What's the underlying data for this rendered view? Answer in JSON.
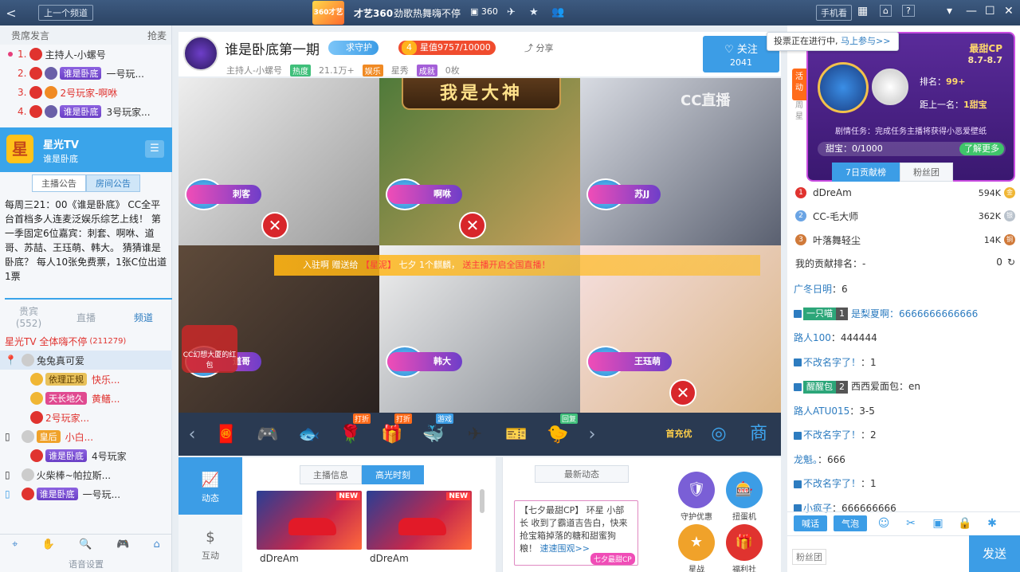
{
  "titlebar": {
    "back": "<",
    "prev_label": "上一个频道",
    "logo_text": "360才艺频道",
    "channel": "才艺360",
    "slogan": "劲歌热舞嗨不停",
    "room_no": "360",
    "phone_label": "手机看",
    "help": "?"
  },
  "left": {
    "header_left": "贵席发言",
    "header_right": "抢麦",
    "ranks": [
      {
        "num": "1.",
        "name": "主持人-小螺号",
        "badge": "",
        "extra": ""
      },
      {
        "num": "2.",
        "name": "",
        "badge": "谁是卧底",
        "extra": "一号玩..."
      },
      {
        "num": "3.",
        "name": "2号玩家-啊咻",
        "badge": "",
        "extra": ""
      },
      {
        "num": "4.",
        "name": "",
        "badge": "谁是卧底",
        "extra": "3号玩家..."
      }
    ],
    "station": {
      "logo": "星",
      "name": "星光TV",
      "sub": "谁是卧底",
      "menu": "☰"
    },
    "notice_tabs": [
      "主播公告",
      "房间公告"
    ],
    "notice": "每周三21：00《谁是卧底》 CC全平台首档多人连麦泛娱乐综艺上线！ 第一季固定6位嘉宾：刺套、啊咻、道哥、苏喆、王珏萌、韩大。 猜猜谁是卧底？ 每人10张免费票，1张C位出道1票",
    "seat_tabs": [
      {
        "label": "贵宾",
        "count": "(552)"
      },
      {
        "label": "直播",
        "count": ""
      },
      {
        "label": "频道",
        "count": ""
      }
    ],
    "guests": [
      {
        "name": "星光TV 全体嗨不停",
        "extra": "(211279)"
      },
      {
        "name": "兔兔真可爱",
        "extra": ""
      },
      {
        "name": "依理正规",
        "extra": "快乐..."
      },
      {
        "name": "天长地久",
        "extra": "黄鳝..."
      },
      {
        "name": "2号玩家...",
        "extra": ""
      },
      {
        "name": "皇后",
        "extra": "小白..."
      },
      {
        "name": "谁是卧底",
        "extra": "4号玩家"
      },
      {
        "name": "火柴棒~帕拉斯...",
        "extra": ""
      },
      {
        "name": "谁是卧底",
        "extra": "一号玩..."
      }
    ],
    "footer": "语音设置"
  },
  "room": {
    "title": "谁是卧底第一期",
    "guard_label": "求守护",
    "star_level": "4",
    "star_value": "星值9757/10000",
    "share": "分享",
    "host": "主持人-小螺号",
    "hot_tag": "热度",
    "viewers": "21.1万+",
    "ent_tag": "娱乐",
    "category": "星秀",
    "achieve_tag": "成就",
    "count": "0枚",
    "follow_label": "关注",
    "follow_count": "2041"
  },
  "video": {
    "banner": "我是大神",
    "cc_logo": "CC直播",
    "gift_msg_pre": "入驻啊 赠送给",
    "gift_msg_name": "【星泥】",
    "gift_msg_mid": "七夕 1个麒麟，",
    "gift_msg_post": "送主播开启全国直播！",
    "cams": [
      {
        "name": "刺客",
        "tag": "谁是卧底"
      },
      {
        "name": "啊咻",
        "tag": "谁是卧底"
      },
      {
        "name": "苏JJ",
        "tag": "谁是卧底"
      },
      {
        "name": "道哥",
        "tag": "谁是卧底"
      },
      {
        "name": "韩大",
        "tag": "谁是卧底"
      },
      {
        "name": "王珏萌",
        "tag": "谁是卧底"
      }
    ],
    "x_mark": "✕",
    "redpacket": "CC幻想大厦的红包"
  },
  "giftbar": {
    "left": "‹",
    "right": "›",
    "gifts": [
      {
        "icon": "🧧",
        "tag": ""
      },
      {
        "icon": "🎮",
        "tag": ""
      },
      {
        "icon": "🐟",
        "tag": ""
      },
      {
        "icon": "🌹",
        "tag": "打折"
      },
      {
        "icon": "🎁",
        "tag": "打折"
      },
      {
        "icon": "🐳",
        "tag": "游戏"
      },
      {
        "icon": "✈",
        "tag": ""
      },
      {
        "icon": "🎫",
        "tag": ""
      },
      {
        "icon": "🐤",
        "tag": "回复"
      }
    ],
    "first_charge": "首充优惠",
    "bag": "背包",
    "shop": "商"
  },
  "bottom": {
    "nav": [
      {
        "icon": "📈",
        "label": "动态"
      },
      {
        "icon": "$",
        "label": "互动"
      }
    ],
    "tabs": [
      "主播信息",
      "高光时刻"
    ],
    "thumbs": [
      {
        "badge": "NEW",
        "name": "dDreAm"
      },
      {
        "badge": "NEW",
        "name": "dDreAm"
      }
    ],
    "news_title": "最新动态",
    "news_text": "【七夕最甜CP】 环星 小部长 收到了霸道吉告白，快来抢宝箱掉落的糖和甜蜜狗粮！",
    "news_link": "速速围观>>",
    "news_tag": "七夕最甜CP",
    "acts": [
      {
        "icon": "🛡",
        "label": "守护优惠"
      },
      {
        "icon": "🎰",
        "label": "扭蛋机"
      },
      {
        "icon": "★",
        "label": "星战"
      },
      {
        "icon": "🎁",
        "label": "福利社"
      }
    ]
  },
  "right": {
    "tooltip": "投票正在进行中,",
    "tooltip_link": "马上参与>>",
    "side_tag": "活动",
    "side_tag2": "周星",
    "cp_title": "最甜CP",
    "cp_date": "8.7-8.7",
    "rank_label": "排名：",
    "rank_value": "99+",
    "gap_label": "距上一名：",
    "gap_value": "1甜宝",
    "task": "剧情任务：完成任务主播将获得小恶爱壁纸",
    "sweet_label": "甜宝：0/1000",
    "more": "了解更多",
    "tabs": [
      "7日贡献榜",
      "粉丝团"
    ],
    "contribs": [
      {
        "rank": "1",
        "name": "dDreAm",
        "amount": "594K"
      },
      {
        "rank": "2",
        "name": "CC-毛大师",
        "amount": "362K"
      },
      {
        "rank": "3",
        "name": "叶落舞轻尘",
        "amount": "14K"
      }
    ],
    "myrank_label": "我的贡献排名：-",
    "myrank_value": "0",
    "chat": [
      {
        "user": "广冬日明",
        "lvl": "",
        "lvn": "",
        "text": "：6"
      },
      {
        "user": "一只喵",
        "lvl": "",
        "lvn": "1",
        "text": "是梨夏啊：6666666666666"
      },
      {
        "user": "路人100",
        "lvl": "",
        "lvn": "",
        "text": "：444444"
      },
      {
        "user": "不改名字了！",
        "lvl": "",
        "lvn": "",
        "text": "：1"
      },
      {
        "user": "",
        "lvl": "醒醒包",
        "lvn": "2",
        "text": "西西爱面包：en"
      },
      {
        "user": "路人ATU015",
        "lvl": "",
        "lvn": "",
        "text": "：3-5"
      },
      {
        "user": "不改名字了！",
        "lvl": "",
        "lvn": "",
        "text": "：2"
      },
      {
        "user": "龙魁。",
        "lvl": "",
        "lvn": "",
        "text": "：666"
      },
      {
        "user": "不改名字了！",
        "lvl": "",
        "lvn": "",
        "text": "：1"
      },
      {
        "user": "小疯子",
        "lvl": "",
        "lvn": "",
        "text": "：666666666"
      }
    ],
    "chat_buttons": [
      "喊话",
      "气泡"
    ],
    "fan_label": "粉丝团",
    "send": "发送"
  }
}
